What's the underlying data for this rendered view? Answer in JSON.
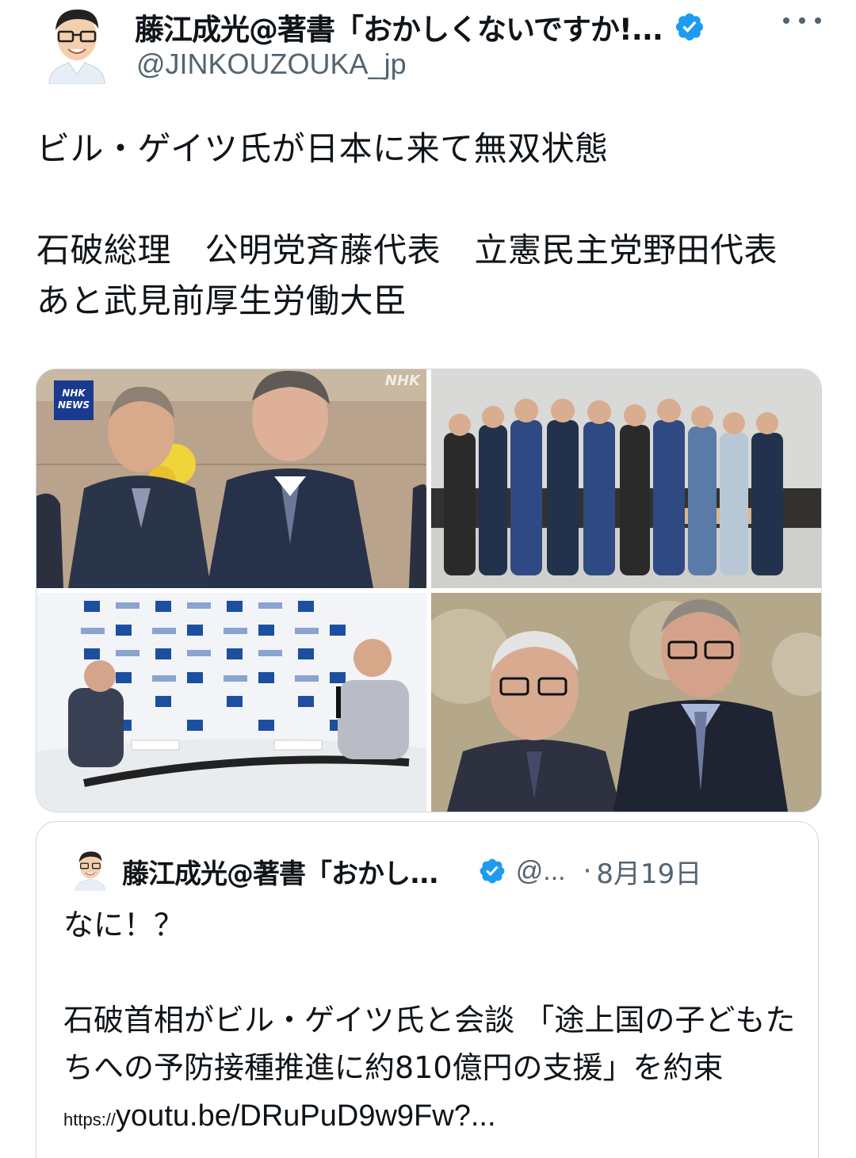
{
  "author": {
    "display_name": "藤江成光@著書「おかしくないですか!...",
    "handle": "@JINKOUZOUKA_jp",
    "avatar_icon": "cartoon-avatar-icon",
    "verified_icon": "verified-badge-icon",
    "more_icon": "more-options-icon"
  },
  "tweet": {
    "text": "ビル・ゲイツ氏が日本に来て無双状態\n\n石破総理　公明党斉藤代表　立憲民主党野田代表　あと武見前厚生労働大臣"
  },
  "media": {
    "photo1": {
      "badge_line1": "NHK",
      "badge_line2": "NEWS",
      "corner_logo": "NHK"
    },
    "zoom_icon": "zoom-icon"
  },
  "quoted": {
    "display_name": "藤江成光@著書「おかし...",
    "handle": "@...",
    "separator": "·",
    "date": "8月19日",
    "text": "なに！？\n\n石破首相がビル・ゲイツ氏と会談 「途上国の子どもたちへの予防接種推進に約810億円の支援」を約束 ",
    "link_prefix": "https://",
    "link_text": "youtu.be/DRuPuD9w9Fw?..."
  },
  "colors": {
    "text": "#0f1419",
    "secondary": "#536471",
    "verified": "#1d9bf0",
    "border": "#cfd9de"
  }
}
